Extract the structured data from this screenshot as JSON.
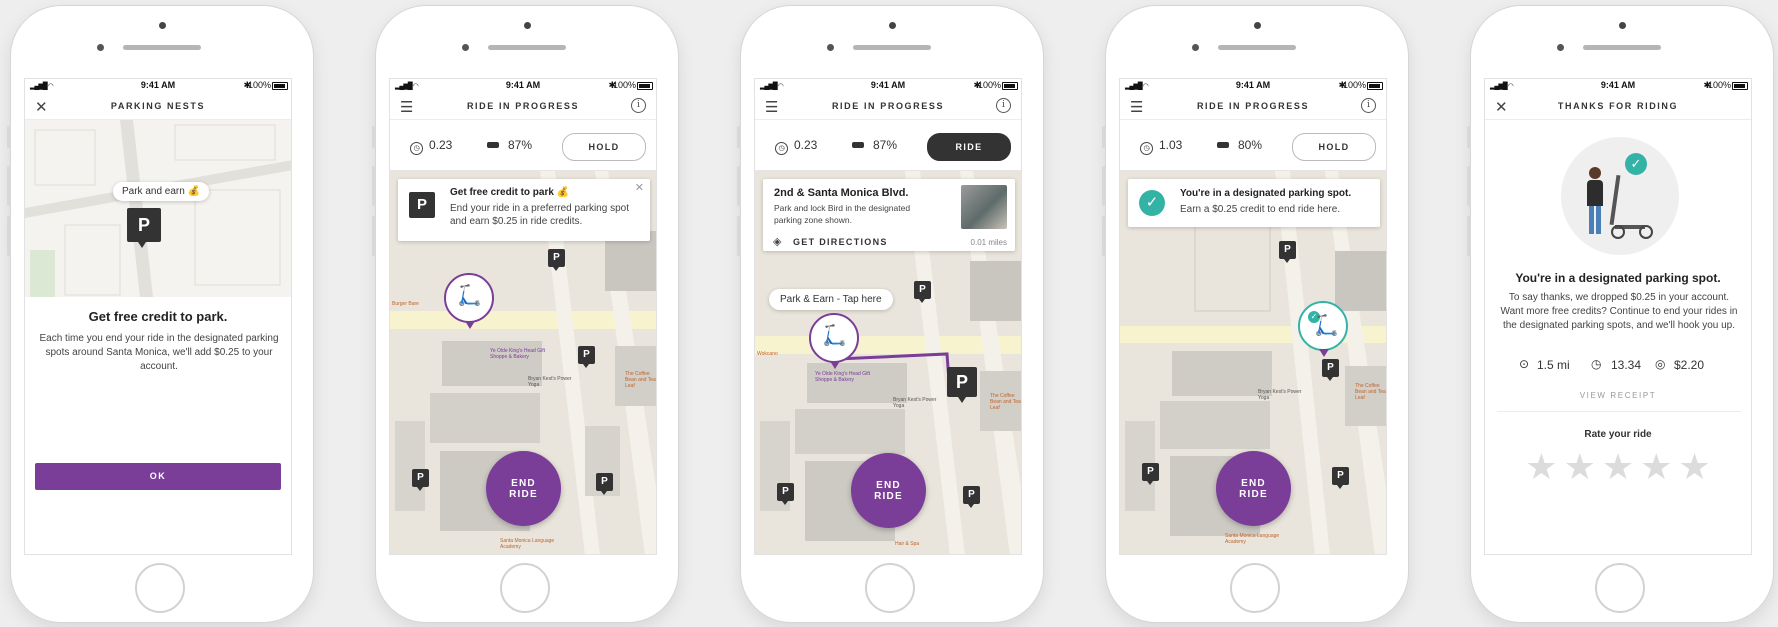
{
  "status_bar": {
    "time": "9:41 AM",
    "battery": "100%"
  },
  "screens": {
    "s1": {
      "title": "PARKING NESTS",
      "tooltip": "Park and earn 💰",
      "pin": "P",
      "heading": "Get free credit to park.",
      "body": "Each time you end your ride in the designated parking spots around Santa Monica, we'll add $0.25 to your account.",
      "ok_label": "OK"
    },
    "s2": {
      "title": "RIDE IN PROGRESS",
      "time": "0.23",
      "battery": "87%",
      "hold_label": "HOLD",
      "banner_title": "Get free credit to park 💰",
      "banner_body": "End your ride in a preferred parking spot and earn $0.25 in ride credits.",
      "end_ride": [
        "END",
        "RIDE"
      ]
    },
    "s3": {
      "title": "RIDE IN PROGRESS",
      "time": "0.23",
      "battery": "87%",
      "ride_label": "RIDE",
      "card_title": "2nd & Santa Monica Blvd.",
      "card_body": "Park and lock Bird in the designated parking zone shown.",
      "directions_label": "GET DIRECTIONS",
      "distance": "0.01 miles",
      "tap_label": "Park & Earn - Tap here",
      "end_ride": [
        "END",
        "RIDE"
      ]
    },
    "s4": {
      "title": "RIDE IN PROGRESS",
      "time": "1.03",
      "battery": "80%",
      "hold_label": "HOLD",
      "banner_title": "You're in a designated parking spot.",
      "banner_body": "Earn a $0.25 credit to end ride here.",
      "end_ride": [
        "END",
        "RIDE"
      ]
    },
    "s5": {
      "title": "THANKS FOR RIDING",
      "heading": "You're in a designated parking spot.",
      "body": "To say thanks, we dropped $0.25 in your account. Want more free credits? Continue to end your rides in the designated parking spots, and we'll hook you up.",
      "distance": "1.5 mi",
      "duration": "13.34",
      "cost": "$2.20",
      "receipt_label": "VIEW RECEIPT",
      "rate_label": "Rate your ride",
      "star_count": 5
    }
  },
  "map_labels": {
    "a": "Ye Olde King's Head Gift Shoppe & Bakery",
    "b": "Bryan Kest's Power Yoga",
    "c": "The Coffee Bean and Tea Leaf",
    "d": "Santa Monica Language Academy",
    "e": "Wokcano",
    "f": "Burger Bare",
    "g": "Hair & Spa"
  },
  "colors": {
    "accent": "#7a3d98",
    "dark": "#333333",
    "check": "#33b3a6",
    "map_bg": "#e9e5dc"
  }
}
